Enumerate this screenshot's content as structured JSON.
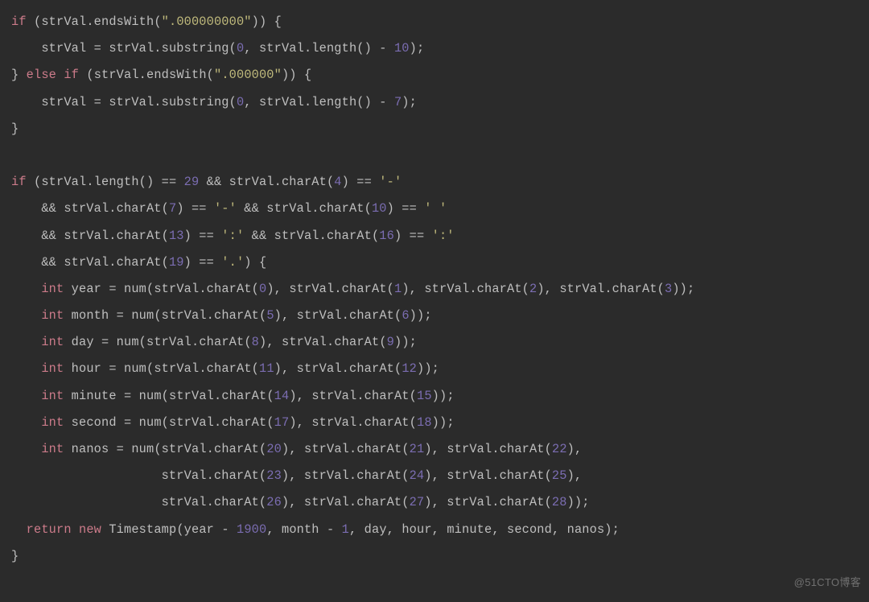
{
  "watermark": "@51CTO博客",
  "tok": {
    "kw_if": "if",
    "kw_else": "else",
    "kw_return": "return",
    "kw_new": "new",
    "kw_int": "int",
    "id_strVal": "strVal",
    "id_endsWith": "endsWith",
    "id_substring": "substring",
    "id_length": "length",
    "id_charAt": "charAt",
    "id_num": "num",
    "id_Timestamp": "Timestamp",
    "id_year": "year",
    "id_month": "month",
    "id_day": "day",
    "id_hour": "hour",
    "id_minute": "minute",
    "id_second": "second",
    "id_nanos": "nanos",
    "str_nine_zeros": "\".000000000\"",
    "str_six_zeros": "\".000000\"",
    "ch_dash": "'-'",
    "ch_space": "' '",
    "ch_colon": "':'",
    "ch_dot": "'.'",
    "n0": "0",
    "n1": "1",
    "n2": "2",
    "n3": "3",
    "n4": "4",
    "n5": "5",
    "n6": "6",
    "n7": "7",
    "n8": "8",
    "n9": "9",
    "n10": "10",
    "n11": "11",
    "n12": "12",
    "n13": "13",
    "n14": "14",
    "n15": "15",
    "n16": "16",
    "n17": "17",
    "n18": "18",
    "n19": "19",
    "n20": "20",
    "n21": "21",
    "n22": "22",
    "n23": "23",
    "n24": "24",
    "n25": "25",
    "n26": "26",
    "n27": "27",
    "n28": "28",
    "n29": "29",
    "n1900": "1900"
  }
}
